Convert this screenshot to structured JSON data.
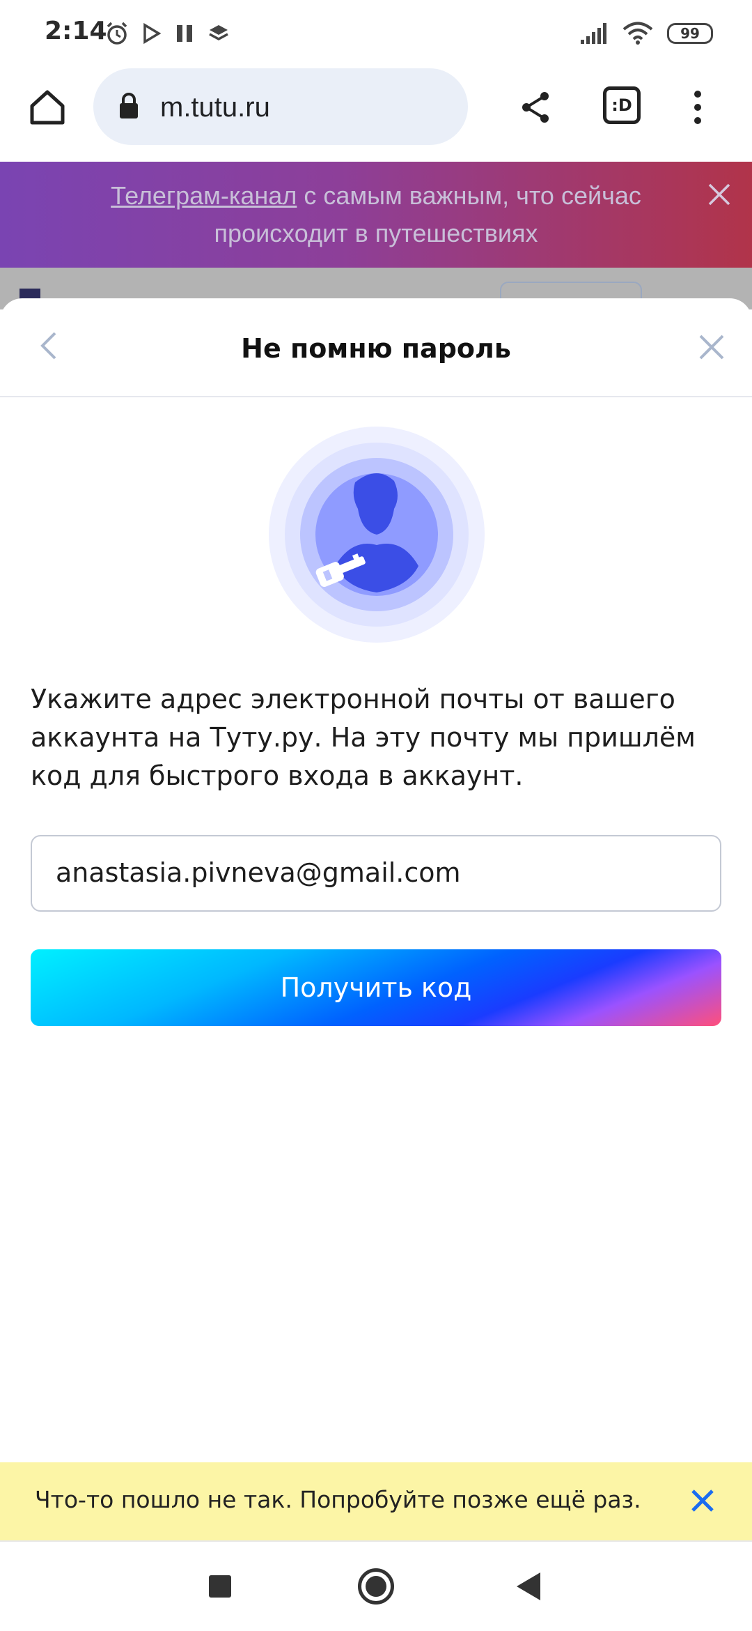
{
  "status_bar": {
    "time": "2:14",
    "battery": "99",
    "left_icons": [
      "alarm-icon",
      "play-store-icon",
      "pause-icon",
      "layers-icon"
    ],
    "right_icons": [
      "signal-icon",
      "wifi-icon",
      "battery-icon"
    ]
  },
  "browser": {
    "url": "m.tutu.ru",
    "tabs_label": ":D",
    "icons": [
      "home-icon",
      "lock-icon",
      "share-icon",
      "tabs-icon",
      "more-vert-icon"
    ]
  },
  "promo": {
    "link_text": "Телеграм-канал",
    "text": " с самым важным, что сейчас происходит в путешествиях"
  },
  "modal": {
    "title": "Не помню пароль",
    "description": "Укажите адрес электронной почты от вашего аккаунта на Туту.ру. На эту почту мы пришлём код для быстрого входа в аккаунт.",
    "email_value": "anastasia.pivneva@gmail.com",
    "submit_label": "Получить код"
  },
  "toast": {
    "message": "Что-то пошло не так. Попробуйте позже ещё раз."
  },
  "colors": {
    "toast_bg": "#fcf5a6",
    "toast_close": "#1a6cf0",
    "illustration_primary": "#3b4ee6",
    "illustration_light": "#eef0ff",
    "promo_gradient_start": "#7a44b2",
    "promo_gradient_end": "#b1344a"
  }
}
